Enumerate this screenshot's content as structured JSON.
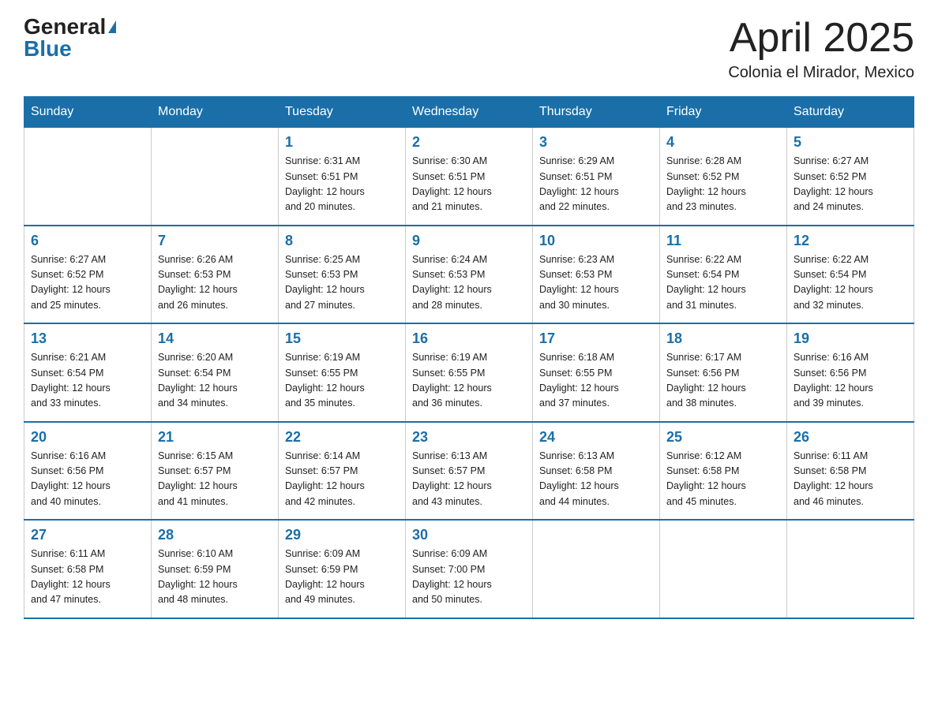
{
  "header": {
    "logo_general": "General",
    "logo_blue": "Blue",
    "month_title": "April 2025",
    "location": "Colonia el Mirador, Mexico"
  },
  "weekdays": [
    "Sunday",
    "Monday",
    "Tuesday",
    "Wednesday",
    "Thursday",
    "Friday",
    "Saturday"
  ],
  "weeks": [
    [
      {
        "day": "",
        "info": ""
      },
      {
        "day": "",
        "info": ""
      },
      {
        "day": "1",
        "info": "Sunrise: 6:31 AM\nSunset: 6:51 PM\nDaylight: 12 hours\nand 20 minutes."
      },
      {
        "day": "2",
        "info": "Sunrise: 6:30 AM\nSunset: 6:51 PM\nDaylight: 12 hours\nand 21 minutes."
      },
      {
        "day": "3",
        "info": "Sunrise: 6:29 AM\nSunset: 6:51 PM\nDaylight: 12 hours\nand 22 minutes."
      },
      {
        "day": "4",
        "info": "Sunrise: 6:28 AM\nSunset: 6:52 PM\nDaylight: 12 hours\nand 23 minutes."
      },
      {
        "day": "5",
        "info": "Sunrise: 6:27 AM\nSunset: 6:52 PM\nDaylight: 12 hours\nand 24 minutes."
      }
    ],
    [
      {
        "day": "6",
        "info": "Sunrise: 6:27 AM\nSunset: 6:52 PM\nDaylight: 12 hours\nand 25 minutes."
      },
      {
        "day": "7",
        "info": "Sunrise: 6:26 AM\nSunset: 6:53 PM\nDaylight: 12 hours\nand 26 minutes."
      },
      {
        "day": "8",
        "info": "Sunrise: 6:25 AM\nSunset: 6:53 PM\nDaylight: 12 hours\nand 27 minutes."
      },
      {
        "day": "9",
        "info": "Sunrise: 6:24 AM\nSunset: 6:53 PM\nDaylight: 12 hours\nand 28 minutes."
      },
      {
        "day": "10",
        "info": "Sunrise: 6:23 AM\nSunset: 6:53 PM\nDaylight: 12 hours\nand 30 minutes."
      },
      {
        "day": "11",
        "info": "Sunrise: 6:22 AM\nSunset: 6:54 PM\nDaylight: 12 hours\nand 31 minutes."
      },
      {
        "day": "12",
        "info": "Sunrise: 6:22 AM\nSunset: 6:54 PM\nDaylight: 12 hours\nand 32 minutes."
      }
    ],
    [
      {
        "day": "13",
        "info": "Sunrise: 6:21 AM\nSunset: 6:54 PM\nDaylight: 12 hours\nand 33 minutes."
      },
      {
        "day": "14",
        "info": "Sunrise: 6:20 AM\nSunset: 6:54 PM\nDaylight: 12 hours\nand 34 minutes."
      },
      {
        "day": "15",
        "info": "Sunrise: 6:19 AM\nSunset: 6:55 PM\nDaylight: 12 hours\nand 35 minutes."
      },
      {
        "day": "16",
        "info": "Sunrise: 6:19 AM\nSunset: 6:55 PM\nDaylight: 12 hours\nand 36 minutes."
      },
      {
        "day": "17",
        "info": "Sunrise: 6:18 AM\nSunset: 6:55 PM\nDaylight: 12 hours\nand 37 minutes."
      },
      {
        "day": "18",
        "info": "Sunrise: 6:17 AM\nSunset: 6:56 PM\nDaylight: 12 hours\nand 38 minutes."
      },
      {
        "day": "19",
        "info": "Sunrise: 6:16 AM\nSunset: 6:56 PM\nDaylight: 12 hours\nand 39 minutes."
      }
    ],
    [
      {
        "day": "20",
        "info": "Sunrise: 6:16 AM\nSunset: 6:56 PM\nDaylight: 12 hours\nand 40 minutes."
      },
      {
        "day": "21",
        "info": "Sunrise: 6:15 AM\nSunset: 6:57 PM\nDaylight: 12 hours\nand 41 minutes."
      },
      {
        "day": "22",
        "info": "Sunrise: 6:14 AM\nSunset: 6:57 PM\nDaylight: 12 hours\nand 42 minutes."
      },
      {
        "day": "23",
        "info": "Sunrise: 6:13 AM\nSunset: 6:57 PM\nDaylight: 12 hours\nand 43 minutes."
      },
      {
        "day": "24",
        "info": "Sunrise: 6:13 AM\nSunset: 6:58 PM\nDaylight: 12 hours\nand 44 minutes."
      },
      {
        "day": "25",
        "info": "Sunrise: 6:12 AM\nSunset: 6:58 PM\nDaylight: 12 hours\nand 45 minutes."
      },
      {
        "day": "26",
        "info": "Sunrise: 6:11 AM\nSunset: 6:58 PM\nDaylight: 12 hours\nand 46 minutes."
      }
    ],
    [
      {
        "day": "27",
        "info": "Sunrise: 6:11 AM\nSunset: 6:58 PM\nDaylight: 12 hours\nand 47 minutes."
      },
      {
        "day": "28",
        "info": "Sunrise: 6:10 AM\nSunset: 6:59 PM\nDaylight: 12 hours\nand 48 minutes."
      },
      {
        "day": "29",
        "info": "Sunrise: 6:09 AM\nSunset: 6:59 PM\nDaylight: 12 hours\nand 49 minutes."
      },
      {
        "day": "30",
        "info": "Sunrise: 6:09 AM\nSunset: 7:00 PM\nDaylight: 12 hours\nand 50 minutes."
      },
      {
        "day": "",
        "info": ""
      },
      {
        "day": "",
        "info": ""
      },
      {
        "day": "",
        "info": ""
      }
    ]
  ]
}
